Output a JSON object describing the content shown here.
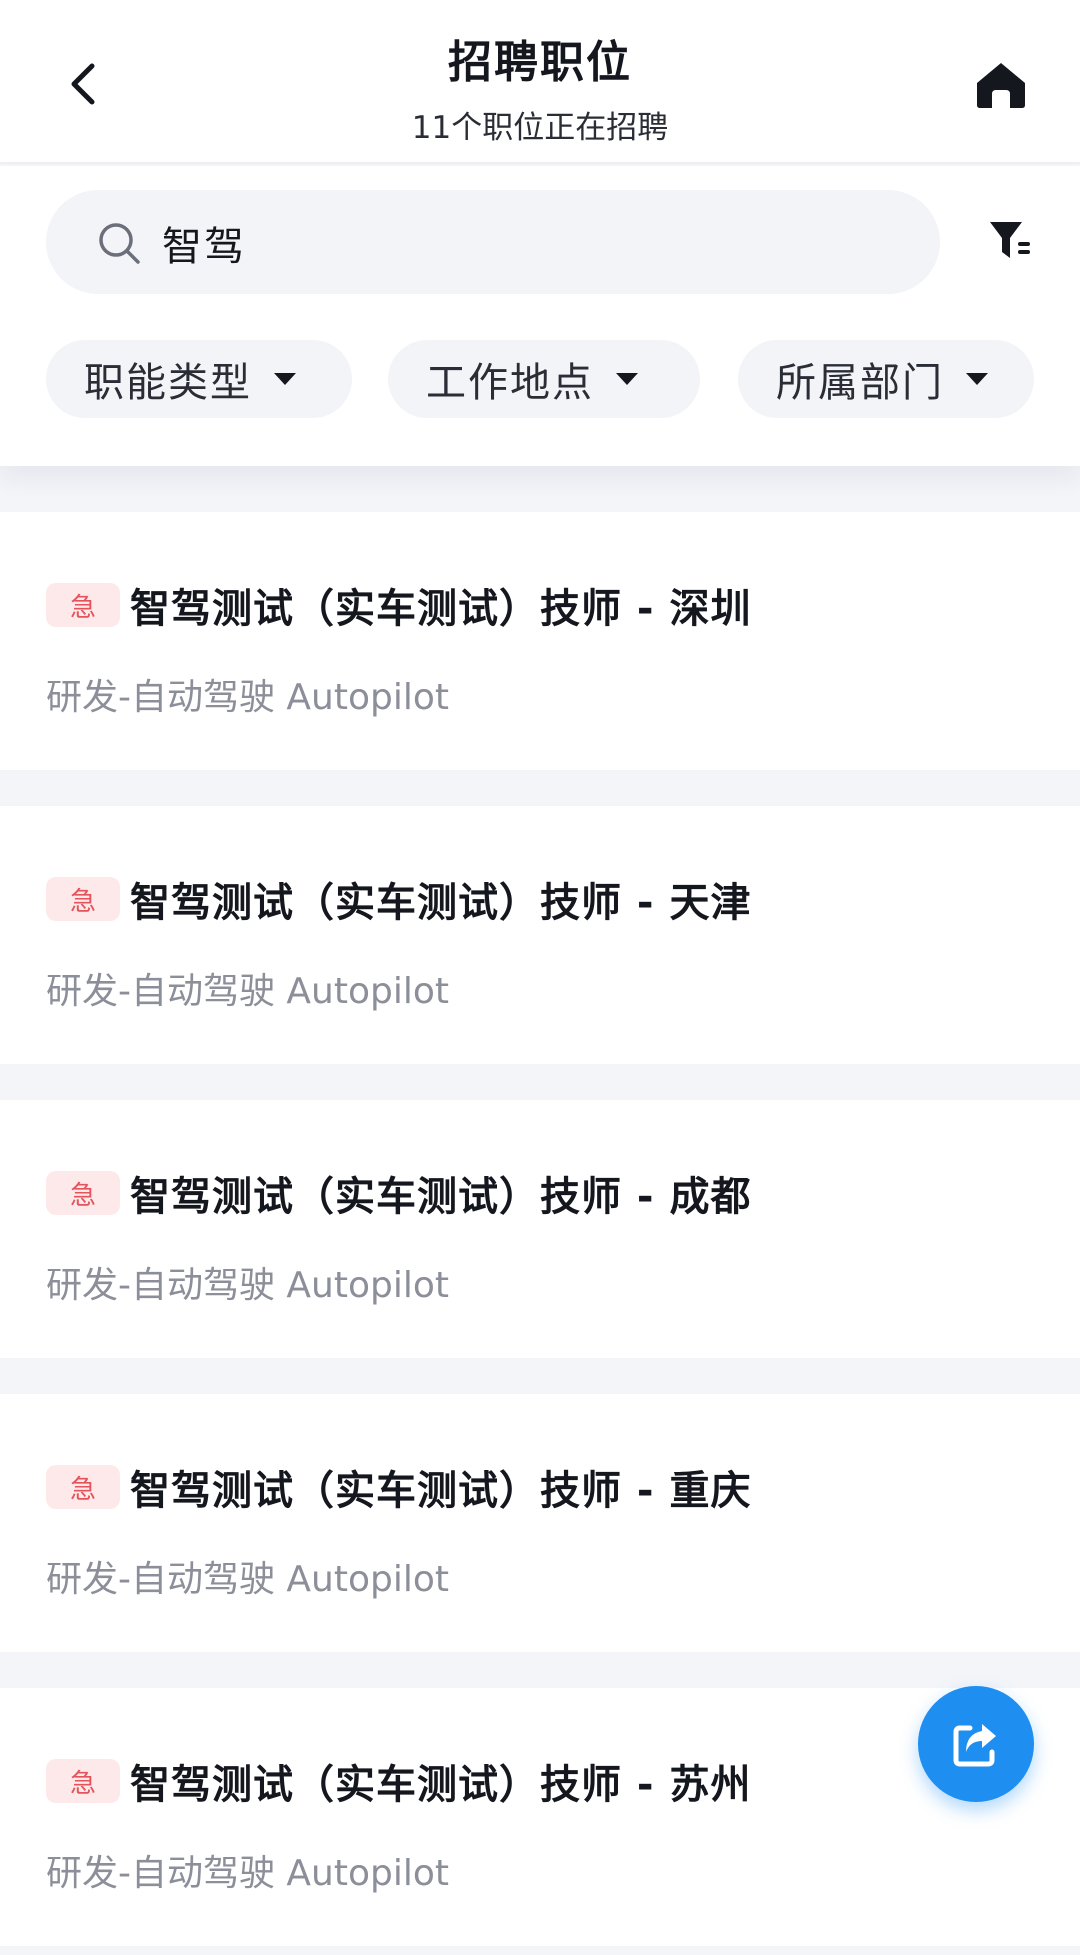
{
  "header": {
    "title": "招聘职位",
    "subtitle": "11个职位正在招聘",
    "back_icon": "chevron-left-icon",
    "home_icon": "home-icon"
  },
  "search": {
    "value": "智驾",
    "icon": "search-icon",
    "filter_icon": "filter-icon"
  },
  "filters": [
    {
      "label": "职能类型"
    },
    {
      "label": "工作地点"
    },
    {
      "label": "所属部门"
    }
  ],
  "jobs": [
    {
      "badge": "急",
      "title": "智驾测试（实车测试）技师 - 深圳",
      "dept": "研发-自动驾驶 Autopilot"
    },
    {
      "badge": "急",
      "title": "智驾测试（实车测试）技师 - 天津",
      "dept": "研发-自动驾驶 Autopilot"
    },
    {
      "badge": "急",
      "title": "智驾测试（实车测试）技师 - 成都",
      "dept": "研发-自动驾驶 Autopilot"
    },
    {
      "badge": "急",
      "title": "智驾测试（实车测试）技师 - 重庆",
      "dept": "研发-自动驾驶 Autopilot"
    },
    {
      "badge": "急",
      "title": "智驾测试（实车测试）技师 - 苏州",
      "dept": "研发-自动驾驶 Autopilot"
    }
  ],
  "share_icon": "share-icon",
  "colors": {
    "accent": "#1f8ef1",
    "urgent_text": "#e4545c",
    "urgent_bg": "#fde9ea",
    "secondary_text": "#8c8f99",
    "page_bg": "#f4f5f9"
  }
}
